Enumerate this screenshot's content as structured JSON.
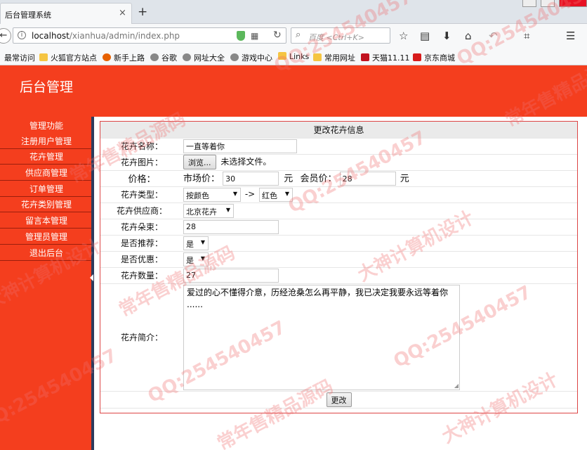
{
  "browser": {
    "tab_title": "后台管理系统",
    "tab_close": "×",
    "new_tab": "+",
    "url_host": "localhost",
    "url_path": "/xianhua/admin/index.php",
    "search_placeholder": "百度 <Ctrl+K>",
    "bookmarks": [
      "最常访问",
      "火狐官方站点",
      "新手上路",
      "谷歌",
      "网址大全",
      "游戏中心",
      "Links",
      "常用网址",
      "天猫11.11",
      "京东商城"
    ]
  },
  "header": {
    "title": "后台管理"
  },
  "sidebar": {
    "items": [
      "管理功能",
      "注册用户管理",
      "花卉管理",
      "供应商管理",
      "订单管理",
      "花卉类别管理",
      "留言本管理",
      "管理员管理",
      "退出后台"
    ]
  },
  "form": {
    "heading": "更改花卉信息",
    "name_label": "花卉名称：",
    "name_value": "一直等着你",
    "image_label": "花卉图片：",
    "browse_button": "浏览...",
    "no_file_text": "未选择文件。",
    "price_label": "价格：",
    "market_price_label": "市场价：",
    "market_price_value": "30",
    "unit_yuan": "元",
    "member_price_label": "会员价：",
    "member_price_value": "28",
    "type_label": "花卉类型：",
    "type_value": "按颜色",
    "type_arrow": "->",
    "subtype_value": "红色",
    "supplier_label": "花卉供应商：",
    "supplier_value": "北京花卉",
    "bouquet_label": "花卉朵束：",
    "bouquet_value": "28",
    "recommend_label": "是否推荐：",
    "recommend_value": "是",
    "discount_label": "是否优惠：",
    "discount_value": "是",
    "quantity_label": "花卉数量：",
    "quantity_value": "27",
    "intro_label": "花卉简介：",
    "intro_value": "爱过的心不懂得介意，历经沧桑怎么再平静，我已决定我要永远等着你 ......",
    "submit_button": "更改"
  },
  "watermarks": [
    "QQ:254540457",
    "常年售精品源码",
    "大神计算机设计"
  ]
}
